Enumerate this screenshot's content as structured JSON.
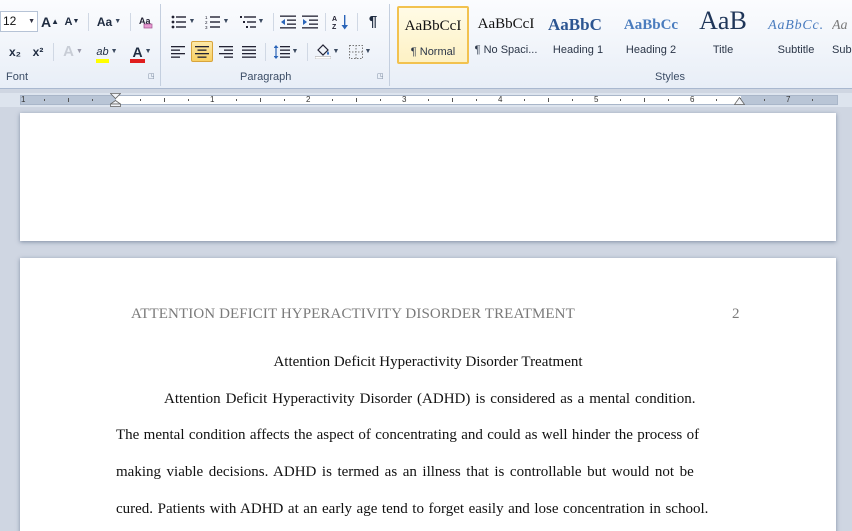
{
  "ribbon": {
    "font_group": {
      "label": "Font",
      "font_size": "12",
      "grow_font": "A",
      "shrink_font": "A",
      "change_case": "Aa",
      "subscript": "x₂",
      "superscript": "x²",
      "text_effects": "A",
      "highlight": "ab",
      "font_color": "A",
      "highlight_color": "#ffff00",
      "font_color_value": "#e01e1e"
    },
    "paragraph_group": {
      "label": "Paragraph",
      "pilcrow": "¶"
    },
    "styles_group": {
      "label": "Styles",
      "items": [
        {
          "preview": "AaBbCcI",
          "name": "¶ Normal",
          "selected": true
        },
        {
          "preview": "AaBbCcI",
          "name": "¶ No Spaci...",
          "selected": false
        },
        {
          "preview": "AaBbC",
          "name": "Heading 1",
          "selected": false
        },
        {
          "preview": "AaBbCc",
          "name": "Heading 2",
          "selected": false
        },
        {
          "preview": "AaB",
          "name": "Title",
          "selected": false
        },
        {
          "preview": "AaBbCc.",
          "name": "Subtitle",
          "selected": false
        },
        {
          "preview": "Aa",
          "name": "Sub",
          "selected": false
        }
      ]
    }
  },
  "ruler": {
    "numbers": [
      "1",
      "1",
      "2",
      "3",
      "4",
      "5",
      "6",
      "7"
    ]
  },
  "document": {
    "page2": {
      "running_head": "ATTENTION DEFICIT HYPERACTIVITY DISORDER TREATMENT",
      "page_number": "2",
      "title": "Attention Deficit Hyperactivity Disorder Treatment",
      "lines": [
        "Attention Deficit Hyperactivity Disorder (ADHD) is considered as a mental condition.",
        "The mental condition affects the aspect of concentrating and could as well hinder the process of",
        "making viable decisions. ADHD is termed as an illness that is controllable but would not be",
        "cured. Patients with ADHD at an early age tend to forget easily and lose concentration in school."
      ]
    }
  }
}
